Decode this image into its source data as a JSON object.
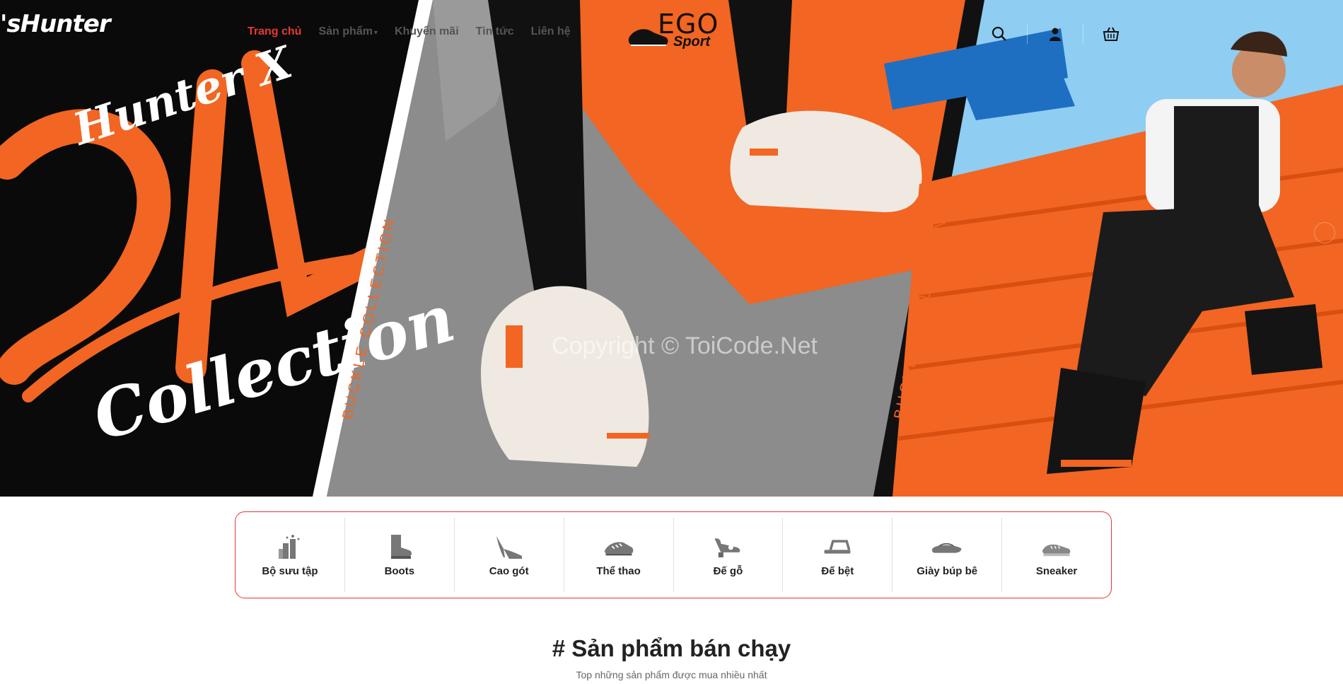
{
  "brand": {
    "left_script": "'sHunter",
    "logo_main": "EGO",
    "logo_sub": "Sport"
  },
  "nav": {
    "items": [
      {
        "label": "Trang chủ",
        "active": true
      },
      {
        "label": "Sản phẩm",
        "active": false,
        "dropdown": true
      },
      {
        "label": "Khuyến mãi",
        "active": false
      },
      {
        "label": "Tin tức",
        "active": false
      },
      {
        "label": "Liên hệ",
        "active": false
      }
    ],
    "icons": [
      "search-icon",
      "user-icon",
      "cart-icon"
    ]
  },
  "hero": {
    "script_line1": "Hunter X",
    "script_line2": "Collection",
    "vertical_label": "BUCKLE COLLECTION",
    "watermark": "Copyright © ToiCode.Net"
  },
  "categories": [
    {
      "label": "Bộ sưu tập",
      "icon": "collection-icon"
    },
    {
      "label": "Boots",
      "icon": "boot-icon"
    },
    {
      "label": "Cao gót",
      "icon": "high-heel-icon"
    },
    {
      "label": "Thể thao",
      "icon": "sport-shoe-icon"
    },
    {
      "label": "Đế gỗ",
      "icon": "wooden-sole-icon"
    },
    {
      "label": "Đế bệt",
      "icon": "flat-sandal-icon"
    },
    {
      "label": "Giày búp bê",
      "icon": "ballet-flat-icon"
    },
    {
      "label": "Sneaker",
      "icon": "sneaker-icon"
    }
  ],
  "best_sellers": {
    "title": "# Sản phẩm bán chạy",
    "subtitle": "Top những sản phẩm được mua nhiều nhất"
  },
  "colors": {
    "accent": "#e53935",
    "orange": "#f26522"
  }
}
